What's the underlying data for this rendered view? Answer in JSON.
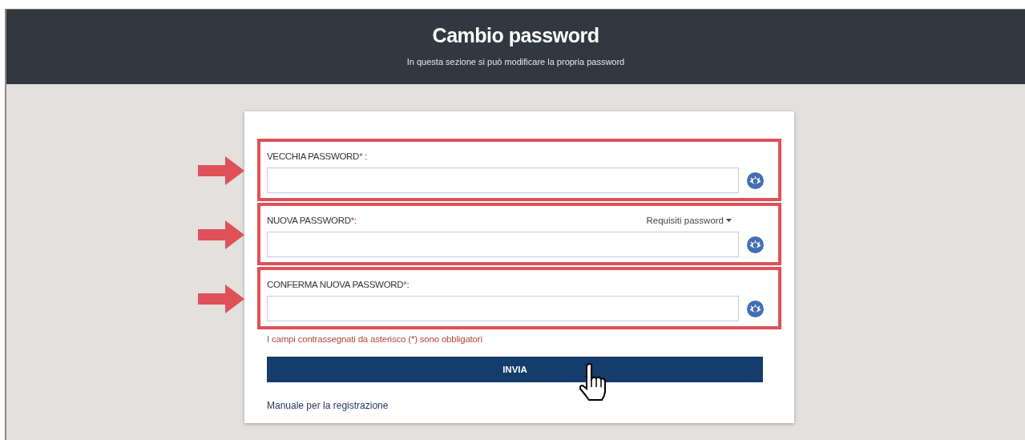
{
  "header": {
    "title": "Cambio password",
    "subtitle": "In questa sezione si può modificare la propria password"
  },
  "fields": [
    {
      "label": "VECCHIA PASSWORD",
      "mark": "*",
      "suffix": " :",
      "highlighted": true
    },
    {
      "label": "NUOVA PASSWORD",
      "mark": "*",
      "suffix": ":",
      "highlighted": true,
      "link": "Requisiti password"
    },
    {
      "label": "CONFERMA NUOVA PASSWORD",
      "mark": "*",
      "suffix": ":",
      "highlighted": true
    }
  ],
  "note": "I campi contrassegnati da asterisco (*) sono obbligatori",
  "submit_button": "INVIA",
  "manual_link": "Manuale per la registrazione"
}
